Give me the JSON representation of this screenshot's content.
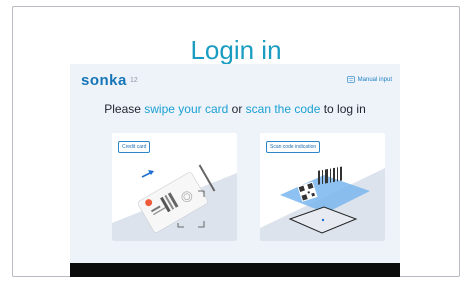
{
  "page": {
    "title": "Login in"
  },
  "header": {
    "brand": "sonka",
    "code": "12",
    "manual_input_label": "Manual input"
  },
  "prompt": {
    "part1": "Please ",
    "swipe": "swipe your card",
    "or": " or ",
    "scan": "scan the code",
    "part2": " to log in"
  },
  "options": [
    {
      "label": "Credit card",
      "icon": "credit-card-swipe-illustration"
    },
    {
      "label": "Scan code indication",
      "icon": "barcode-scan-illustration"
    }
  ],
  "colors": {
    "accent": "#1ba0d2",
    "brand": "#1675b7",
    "panel_bg": "#eef3fa",
    "bottom_bar": "#0b0b0b"
  }
}
